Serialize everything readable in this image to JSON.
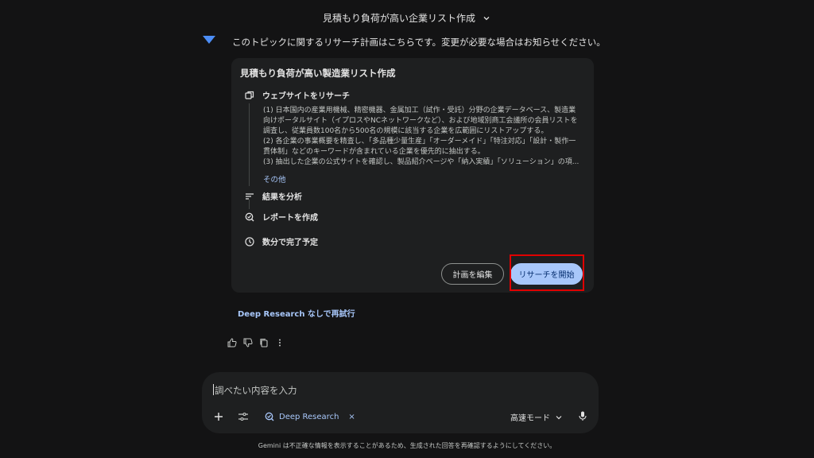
{
  "header": {
    "title": "見積もり負荷が高い企業リスト作成"
  },
  "response": {
    "intro": "このトピックに関するリサーチ計画はこちらです。変更が必要な場合はお知らせください。",
    "plan": {
      "title": "見積もり負荷が高い製造業リスト作成",
      "steps": [
        {
          "label": "ウェブサイトをリサーチ",
          "icon": "web-icon"
        },
        {
          "label": "結果を分析",
          "icon": "analyze-icon"
        },
        {
          "label": "レポートを作成",
          "icon": "report-icon"
        },
        {
          "label": "数分で完了予定",
          "icon": "clock-icon"
        }
      ],
      "details": [
        "(1) 日本国内の産業用機械、精密機器、金属加工（試作・受託）分野の企業データベース、製造業",
        "向けポータルサイト（イプロスやNCネットワークなど）、および地域別商工会議所の会員リストを",
        "調査し、従業員数100名から500名の規模に該当する企業を広範囲にリストアップする。",
        "(2) 各企業の事業概要を精査し、「多品種少量生産」「オーダーメイド」「特注対応」「設計・製作一",
        "貫体制」などのキーワードが含まれている企業を優先的に抽出する。",
        "(3) 抽出した企業の公式サイトを確認し、製品紹介ページや「納入実績」「ソリューション」の項..."
      ],
      "more": "その他",
      "edit_button": "計画を編集",
      "start_button": "リサーチを開始"
    },
    "retry_link": "Deep Research なしで再試行"
  },
  "composer": {
    "placeholder": "調べたい内容を入力",
    "chip": "Deep Research",
    "chip_close": "×",
    "mode": "高速モード"
  },
  "footer": "Gemini は不正確な情報を表示することがあるため、生成された回答を再確認するようにしてください。",
  "colors": {
    "accent": "#a8c7fa",
    "highlight": "#e00000",
    "background": "#131314",
    "card": "#1e1f20"
  }
}
